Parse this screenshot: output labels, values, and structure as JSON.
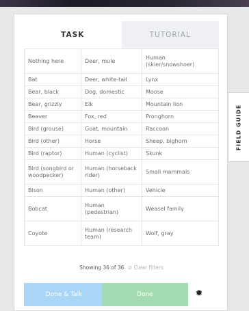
{
  "tabs": {
    "task": "TASK",
    "tutorial": "TUTORIAL"
  },
  "choices": [
    [
      "Nothing here",
      "Deer, mule",
      "Human (skier/snowshoer)"
    ],
    [
      "Bat",
      "Deer, white-tail",
      "Lynx"
    ],
    [
      "Bear, black",
      "Dog, domestic",
      "Moose"
    ],
    [
      "Bear, grizzly",
      "Elk",
      "Mountain lion"
    ],
    [
      "Beaver",
      "Fox, red",
      "Pronghorn"
    ],
    [
      "Bird (grouse)",
      "Goat, mountain",
      "Raccoon"
    ],
    [
      "Bird (other)",
      "Horse",
      "Sheep, bighorn"
    ],
    [
      "Bird (raptor)",
      "Human (cyclist)",
      "Skunk"
    ],
    [
      "Bird (songbird or woodpecker)",
      "Human (horseback rider)",
      "Small mammals"
    ],
    [
      "Bison",
      "Human (other)",
      "Vehicle"
    ],
    [
      "Bobcat",
      "Human (pedestrian)",
      "Weasel family"
    ],
    [
      "Coyote",
      "Human (research team)",
      "Wolf, gray"
    ]
  ],
  "filter": {
    "showing": "Showing 36 of 36",
    "clear": "Clear filters"
  },
  "buttons": {
    "done_talk": "Done & Talk",
    "done": "Done"
  },
  "icons": {
    "settings": "gear-icon",
    "clear": "circle-slash-icon"
  },
  "field_guide": "FIELD GUIDE",
  "colors": {
    "done_talk": "#a9d6f6",
    "done": "#a5dbb0"
  }
}
